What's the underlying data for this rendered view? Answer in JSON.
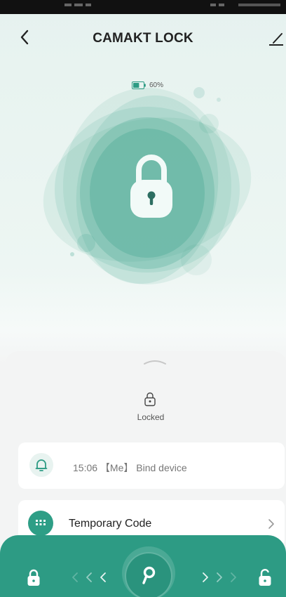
{
  "header": {
    "title": "CAMAKT LOCK",
    "back_icon": "chevron-left-icon",
    "edit_icon": "pencil-icon"
  },
  "device": {
    "battery_text": "60%",
    "battery_level": 0.6,
    "lock_state_label": "Locked"
  },
  "log": {
    "entry_text": "15:06 【Me】 Bind device",
    "icon": "bell-icon"
  },
  "menu": {
    "temporary_code_label": "Temporary Code",
    "temporary_code_icon": "keypad-icon",
    "chevron_icon": "chevron-right-icon"
  },
  "bottom_bar": {
    "lock_icon": "lock-closed-icon",
    "unlock_icon": "lock-open-icon",
    "center_icon": "key-icon"
  },
  "colors": {
    "accent": "#2d9b84",
    "background": "#e6f2ef",
    "card": "#ffffff"
  }
}
